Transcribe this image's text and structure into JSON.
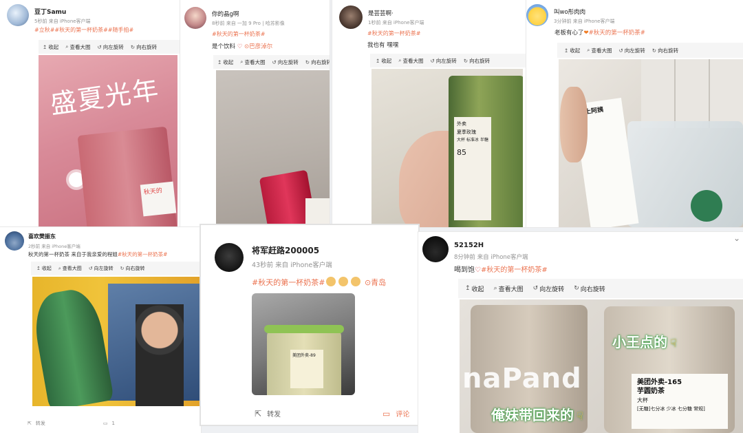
{
  "toolbar_labels": {
    "collapse": "收起",
    "view": "查看大图",
    "rotate_left": "向左旋转",
    "rotate_right": "向右旋转"
  },
  "posts": [
    {
      "user": "豆丁Samu",
      "time": "5秒前",
      "source": "来自 iPhone客户端",
      "tags": "#立秋##秋天的第一杯奶茶##随手拍#",
      "photo_text": "盛夏光年",
      "photo_label": "秋天的"
    },
    {
      "user": "你的晶g啊",
      "time": "8秒前",
      "source": "来自 一加 9 Pro | 哈苏影像",
      "tag": "#秋天的第一杯奶茶#",
      "text": "是个饮料",
      "location": "巴彦淖尔"
    },
    {
      "user": "是芸芸啊·",
      "time": "1秒前",
      "source": "来自 iPhone客户端",
      "tag": "#秋天的第一杯奶茶#",
      "text": "我也有 嘿嘿",
      "receipt_lines": [
        "外卖",
        "夏季玫瑰",
        "大杯 标准冰 半糖",
        "85"
      ]
    },
    {
      "user": "叫wo彤肉肉",
      "time": "3分钟前",
      "source": "来自 iPhone客户端",
      "text": "老板有心了",
      "tag": "#秋天的第一杯奶茶#",
      "receipt_title": "沪上阿姨"
    },
    {
      "user": "喜欢樊振东",
      "time": "2秒前",
      "source": "来自 iPhone客户端",
      "text": "秋天的第一杯奶茶 来自于我亲爱的程姐",
      "tag": "#秋天的第一杯奶茶#",
      "repost": "转发",
      "comment_count": "1"
    },
    {
      "user": "将军赶路200005",
      "time": "43秒前",
      "source": "来自 iPhone客户端",
      "tag": "#秋天的第一杯奶茶#",
      "location": "青岛",
      "label_text": "美团外卖-89",
      "repost": "转发",
      "comment": "评论"
    },
    {
      "user": "52152H",
      "time": "8分钟前",
      "source": "来自 iPhone客户端",
      "text": "喝到饱",
      "tag": "#秋天的第一杯奶茶#",
      "banner1": "小王点的",
      "banner2": "俺妹带回来的",
      "cup_title": "美团外卖-165",
      "cup_name": "芋圆奶茶",
      "cup_size": "大杯",
      "cup_note": "[无糖]七分冰 少冰 七分糖 常规]",
      "cup_brand": "naPand"
    }
  ],
  "colors": {
    "tag": "#eb7350",
    "meta": "#939393",
    "toolbar_bg": "#f5f5f5"
  }
}
